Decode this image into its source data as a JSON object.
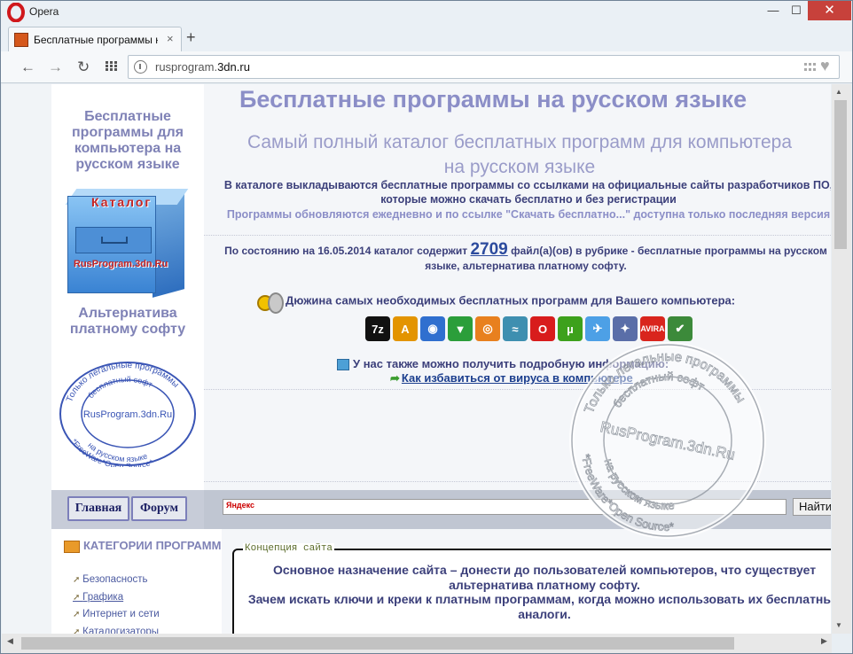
{
  "window": {
    "app_title": "Opera",
    "minimize": "—",
    "maximize": "☐",
    "close": "✕"
  },
  "tab": {
    "label": "Бесплатные программы н",
    "close": "×",
    "new_tab": "+"
  },
  "address_bar": {
    "url_host": "rusprogram.",
    "url_domain": "3dn.ru"
  },
  "nav": {
    "back": "←",
    "forward": "→",
    "reload": "↻"
  },
  "sidebar": {
    "title": "Бесплатные программы для компьютера на русском языке",
    "catalog_label": "Каталог",
    "catalog_url": "RusProgram.3dn.Ru",
    "alternative": "Альтернатива платному софту",
    "seal_top": "Только легальные программы",
    "seal_inner": "бесплатный софт",
    "seal_center": "RusProgram.3dn.Ru",
    "seal_bottom": "на русском языке",
    "seal_footer": "*FreeWare*Open Source*"
  },
  "main": {
    "heading": "Бесплатные программы на русском языке",
    "subheading": "Самый полный каталог бесплатных программ для компьютера на русском языке",
    "intro": "В каталоге выкладываются бесплатные программы со ссылками на официальные сайты разработчиков ПО, которые можно скачать бесплатно и без регистрации",
    "update_note": "Программы обновляются ежедневно и по ссылке \"Скачать бесплатно...\" доступна только последняя версия",
    "status_before": "По состоянию на 16.05.2014 каталог содержит",
    "count": "2709",
    "status_after": "файл(а)(ов) в рубрике - бесплатные программы на русском языке, альтернатива платному софту.",
    "dozen": "Дюжина самых необходимых бесплатных программ для Вашего компьютера:",
    "apps": [
      {
        "name": "7zip-icon",
        "glyph": "7z",
        "color": "#111111"
      },
      {
        "name": "aimp-icon",
        "glyph": "A",
        "color": "#e39400"
      },
      {
        "name": "firefox-icon",
        "glyph": "◉",
        "color": "#2f6fcf"
      },
      {
        "name": "mapping-icon",
        "glyph": "▼",
        "color": "#2b9e3a"
      },
      {
        "name": "viewer-eye-icon",
        "glyph": "◎",
        "color": "#e8801e"
      },
      {
        "name": "chart-icon",
        "glyph": "≈",
        "color": "#3e8fb0"
      },
      {
        "name": "opera-icon",
        "glyph": "O",
        "color": "#d81c1c"
      },
      {
        "name": "utorrent-icon",
        "glyph": "µ",
        "color": "#3da11c"
      },
      {
        "name": "skype-icon",
        "glyph": "✈",
        "color": "#4da0e6"
      },
      {
        "name": "cd-burner-icon",
        "glyph": "✦",
        "color": "#5a6ea8"
      },
      {
        "name": "avira-icon",
        "glyph": "A",
        "color": "#d9251d"
      },
      {
        "name": "shield-check-icon",
        "glyph": "✔",
        "color": "#3c8a3a"
      }
    ],
    "avira_label": "AVIRA",
    "info": "У нас также можно получить подробную информацию:",
    "virus_link": "Как избавиться от вируса в компьютере"
  },
  "navbar": {
    "home": "Главная",
    "forum": "Форум",
    "yandex_label": "Яндекс",
    "search_button": "Найти"
  },
  "categories": {
    "title": "КАТЕГОРИИ ПРОГРАММ",
    "items": [
      "Безопасность",
      "Графика",
      "Интернет и сети",
      "Каталогизаторы"
    ]
  },
  "concept": {
    "legend": "Концепция сайта",
    "text1": "Основное назначение сайта – донести до пользователей компьютеров, что существует альтернатива платному софту.",
    "text2": "Зачем искать ключи и креки к платным программам, когда можно использовать их бесплатные аналоги."
  },
  "colors": {
    "accent": "#8b8ec7",
    "text_dark": "#3b3f7a",
    "link": "#1c3f8e",
    "close_red": "#c7413b"
  }
}
